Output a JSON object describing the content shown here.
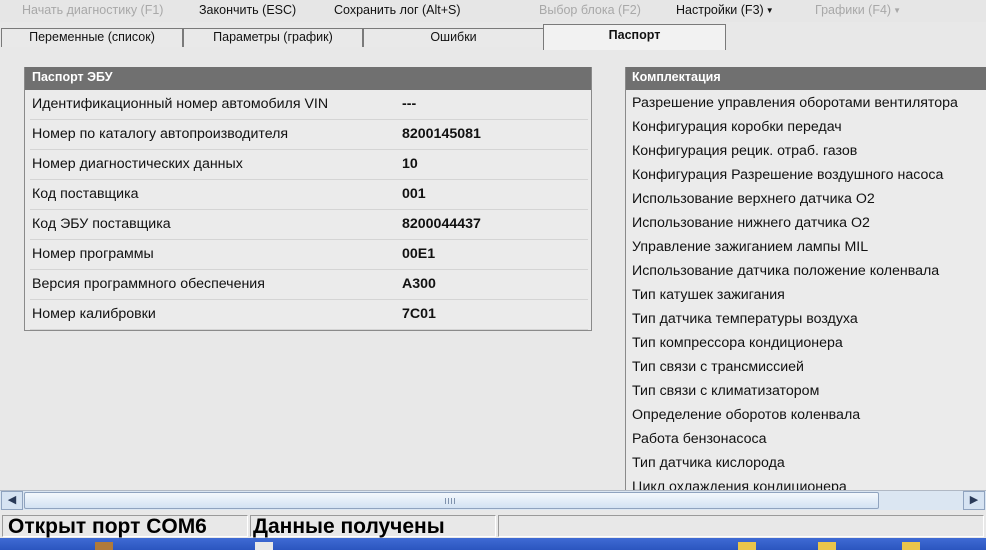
{
  "menu": {
    "start_diag": "Начать диагностику (F1)",
    "finish": "Закончить (ESC)",
    "save_log": "Сохранить лог (Alt+S)",
    "select_block": "Выбор блока (F2)",
    "settings": "Настройки (F3)",
    "graphs": "Графики (F4)"
  },
  "tabs": [
    {
      "label": "Переменные (список)"
    },
    {
      "label": "Параметры (график)"
    },
    {
      "label": "Ошибки"
    },
    {
      "label": "Паспорт"
    }
  ],
  "ecu_passport": {
    "title": "Паспорт ЭБУ",
    "rows": [
      {
        "label": "Идентификационный номер автомобиля VIN",
        "value": "---"
      },
      {
        "label": "Номер по каталогу автопроизводителя",
        "value": "8200145081"
      },
      {
        "label": "Номер диагностических данных",
        "value": "10"
      },
      {
        "label": "Код поставщика",
        "value": "001"
      },
      {
        "label": "Код ЭБУ поставщика",
        "value": "8200044437"
      },
      {
        "label": "Номер программы",
        "value": "00E1"
      },
      {
        "label": "Версия программного обеспечения",
        "value": "A300"
      },
      {
        "label": "Номер калибровки",
        "value": "7C01"
      }
    ]
  },
  "equipment": {
    "title": "Комплектация",
    "items": [
      "Разрешение управления оборотами вентилятора",
      "Конфигурация коробки передач",
      "Конфигурация рецик. отраб. газов",
      "Конфигурация Разрешение воздушного насоса",
      "Использование верхнего датчика О2",
      "Использование нижнего датчика О2",
      "Управление зажиганием лампы MIL",
      "Использование датчика положение коленвала",
      "Тип катушек зажигания",
      "Тип датчика температуры воздуха",
      "Тип компрессора кондиционера",
      "Тип связи с трансмиссией",
      "Тип связи с климатизатором",
      "Определение оборотов коленвала",
      "Работа бензонасоса",
      "Тип датчика кислорода",
      "Цикл охлаждения кондиционера"
    ]
  },
  "status": {
    "port": "Открыт порт COM6",
    "data": "Данные получены"
  },
  "colors": {
    "header_bg": "#707070",
    "scrollbar": "#dbe6f2",
    "taskbar": "#2b55bf"
  }
}
